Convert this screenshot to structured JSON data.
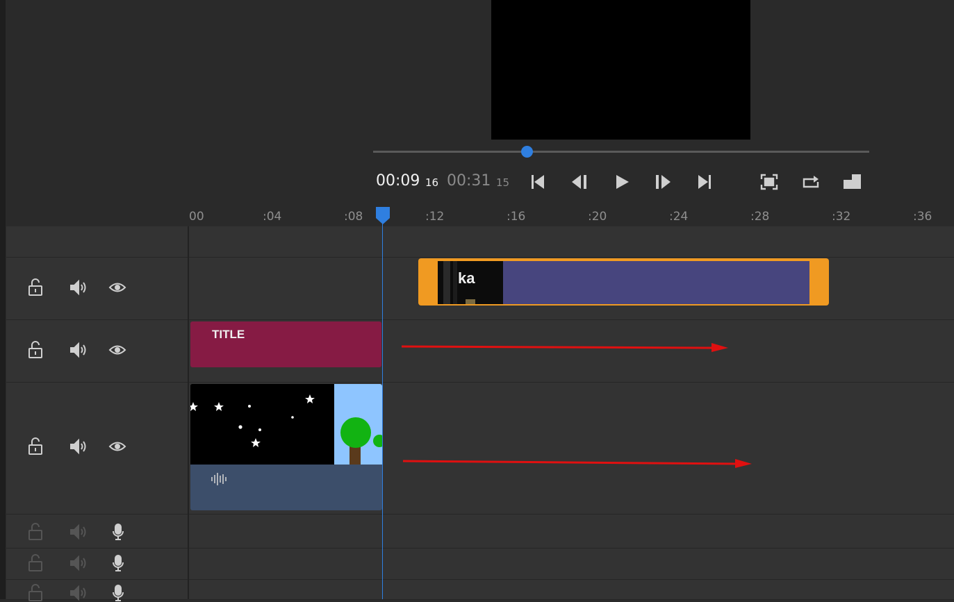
{
  "player": {
    "current_time": "00:09",
    "current_frames": "16",
    "duration_time": "00:31",
    "duration_frames": "15",
    "progress_fraction": 0.31
  },
  "controls": [
    {
      "name": "skip-to-start-icon"
    },
    {
      "name": "step-back-icon"
    },
    {
      "name": "play-icon"
    },
    {
      "name": "step-forward-icon"
    },
    {
      "name": "skip-to-end-icon"
    },
    {
      "name": "fullscreen-icon"
    },
    {
      "name": "loop-icon"
    },
    {
      "name": "export-frame-icon"
    }
  ],
  "ruler": {
    "ticks": [
      "00",
      ":04",
      ":08",
      ":12",
      ":16",
      ":20",
      ":24",
      ":28",
      ":32",
      ":36"
    ]
  },
  "timeline": {
    "title_clip_label": "TITLE",
    "video_thumb_text": "ka"
  },
  "colors": {
    "accent": "#2f7fe0",
    "video_clip_border": "#f09a22",
    "video_clip_body": "#47457e",
    "title_clip": "#861b44",
    "audio_clip": "#3c4e6a",
    "arrow": "#e01010"
  }
}
